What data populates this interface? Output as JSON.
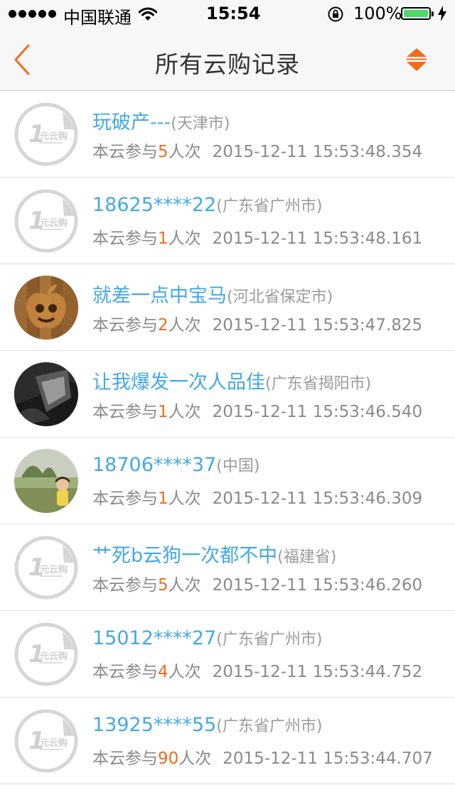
{
  "status_bar": {
    "carrier": "中国联通",
    "time": "15:54",
    "battery": "100%",
    "battery_fill": 1.0,
    "battery_color": "#4cd964"
  },
  "nav": {
    "title": "所有云购记录",
    "back_icon": "chevron-left-icon",
    "sort_icon": "sort-updown-icon",
    "accent_color": "#f26c1a"
  },
  "default_avatar_text": "1元云购",
  "records": [
    {
      "name": "玩破产---",
      "region": "(天津市)",
      "prefix": "本云参与",
      "count": "5",
      "suffix": "人次",
      "time": "2015-12-11 15:53:48.354",
      "avatar": "default"
    },
    {
      "name": "18625****22",
      "region": "(广东省广州市)",
      "prefix": "本云参与",
      "count": "1",
      "suffix": "人次",
      "time": "2015-12-11 15:53:48.161",
      "avatar": "default"
    },
    {
      "name": "就差一点中宝马",
      "region": "(河北省保定市)",
      "prefix": "本云参与",
      "count": "2",
      "suffix": "人次",
      "time": "2015-12-11 15:53:47.825",
      "avatar": "wood-apple"
    },
    {
      "name": "让我爆发一次人品佳",
      "region": "(广东省揭阳市)",
      "prefix": "本云参与",
      "count": "1",
      "suffix": "人次",
      "time": "2015-12-11 15:53:46.540",
      "avatar": "dark-photo"
    },
    {
      "name": "18706****37",
      "region": "(中国)",
      "prefix": "本云参与",
      "count": "1",
      "suffix": "人次",
      "time": "2015-12-11 15:53:46.309",
      "avatar": "child-photo"
    },
    {
      "name": "艹死b云狗一次都不中",
      "region": "(福建省)",
      "prefix": "本云参与",
      "count": "5",
      "suffix": "人次",
      "time": "2015-12-11 15:53:46.260",
      "avatar": "default"
    },
    {
      "name": "15012****27",
      "region": "(广东省广州市)",
      "prefix": "本云参与",
      "count": "4",
      "suffix": "人次",
      "time": "2015-12-11 15:53:44.752",
      "avatar": "default"
    },
    {
      "name": "13925****55",
      "region": "(广东省广州市)",
      "prefix": "本云参与",
      "count": "90",
      "suffix": "人次",
      "time": "2015-12-11 15:53:44.707",
      "avatar": "default"
    }
  ]
}
